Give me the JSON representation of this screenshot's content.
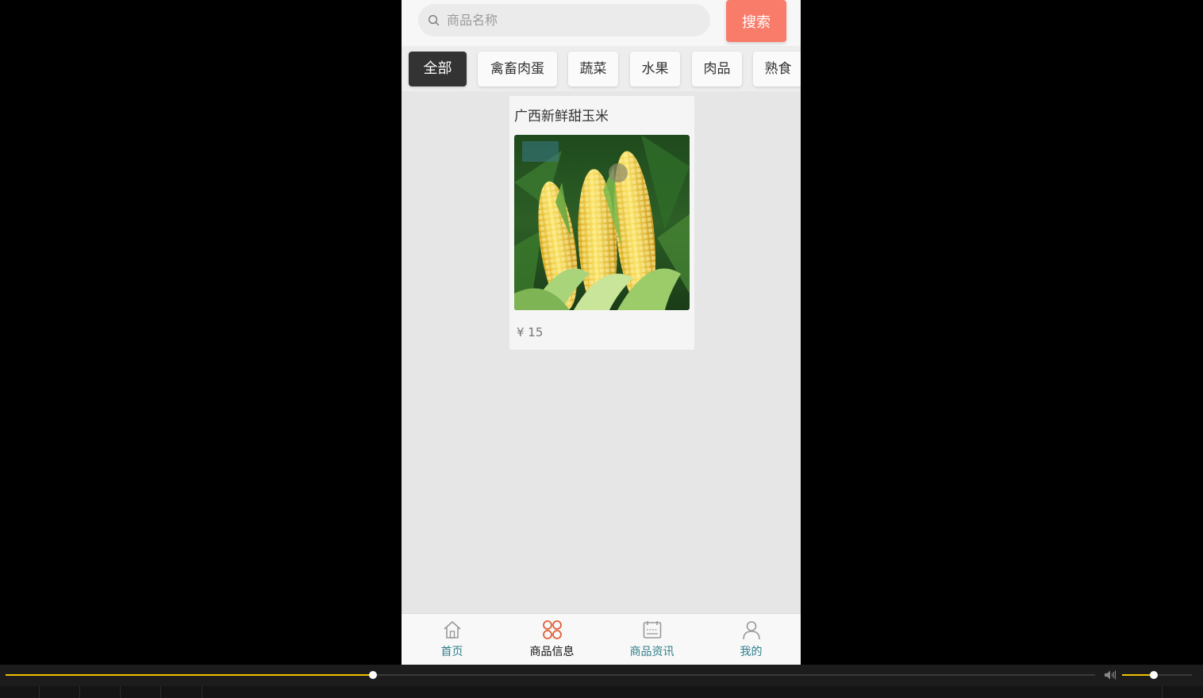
{
  "search": {
    "placeholder": "商品名称",
    "button_label": "搜索",
    "button_color": "#f97c6b"
  },
  "categories": [
    {
      "label": "全部",
      "active": true
    },
    {
      "label": "禽畜肉蛋",
      "active": false
    },
    {
      "label": "蔬菜",
      "active": false
    },
    {
      "label": "水果",
      "active": false
    },
    {
      "label": "肉品",
      "active": false
    },
    {
      "label": "熟食",
      "active": false
    }
  ],
  "products": [
    {
      "name": "广西新鲜甜玉米",
      "price": "¥ 15",
      "image": "corn-photo"
    }
  ],
  "tabbar": {
    "items": [
      {
        "label": "首页",
        "icon": "home-icon",
        "active": false
      },
      {
        "label": "商品信息",
        "icon": "grid-icon",
        "active": true
      },
      {
        "label": "商品资讯",
        "icon": "news-icon",
        "active": false
      },
      {
        "label": "我的",
        "icon": "user-icon",
        "active": false
      }
    ],
    "active_color": "#e0603a",
    "label_color": "#2f7e8a"
  },
  "player": {
    "progress_fraction": 0.337,
    "volume_fraction": 0.45,
    "accent_color": "#f0c000"
  }
}
